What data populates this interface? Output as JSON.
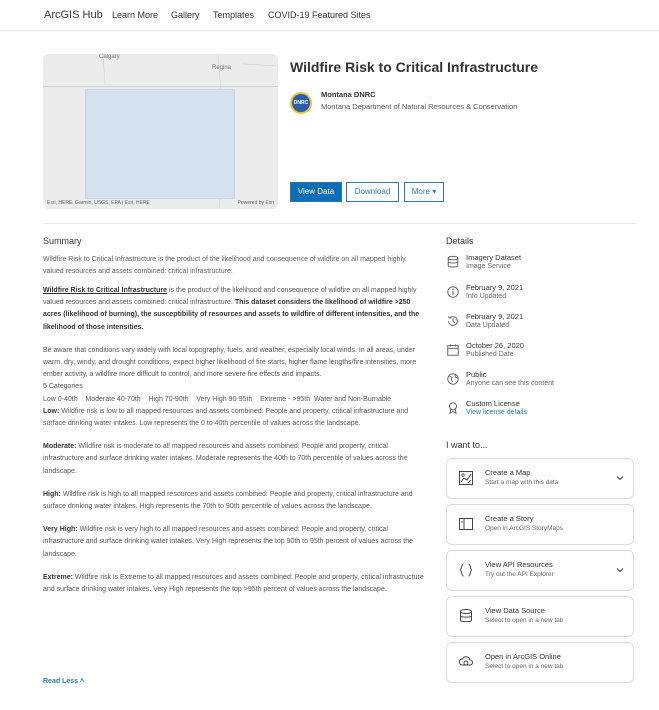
{
  "nav": {
    "brand": "ArcGIS Hub",
    "links": [
      "Learn More",
      "Gallery",
      "Templates",
      "COVID-19 Featured Sites"
    ]
  },
  "map": {
    "cities": [
      "Calgary",
      "Regina"
    ],
    "attribution_left": "Esri, HERE, Garmin, USGS, EPA | Esri, HERE",
    "attribution_right": "Powered by Esri"
  },
  "header": {
    "title": "Wildfire Risk to Critical Infrastructure",
    "org_short": "Montana DNRC",
    "org_full": "Montana Department of Natural Resources & Conservation",
    "org_logo_text": "DNRC"
  },
  "buttons": {
    "view_data": "View Data",
    "download": "Download",
    "more": "More ▾"
  },
  "summary": {
    "heading": "Summary",
    "text": "Wildfire Risk to Critical Infrastructure is the product of the likelihood and consequence of wildfire on all mapped highly valued resources and assets combined: critical infrastructure."
  },
  "description": {
    "p1_title": "Wildfire Risk to Critical Infrastructure",
    "p1_a": " is the product of the likelihood and consequence of wildfire on all mapped highly valued resources and assets combined: critical infrastructure. ",
    "p1_b": "This dataset considers the likelihood of wildfire >250 acres (likelihood of burning), the susceptibility of resources and assets to wildfire of different intensities, and the likelihood of those intensities.",
    "p2": "Be aware that conditions vary widely with local topography, fuels, and weather, especially local winds. In all areas, under warm, dry, windy, and drought conditions, expect higher likelihood of fire starts, higher flame lengths/fire intensities, more ember activity, a wildfire more difficult to control, and more severe fire effects and impacts.",
    "categories_count": "5 Categories",
    "categories_list": "Low 0-40th    Moderate 40-70th    High 70-90th    Very High 90-95th    Extreme - >95th  Water and Non-Burnable",
    "low_label": "Low:",
    "low_text": " Wildfire risk is low to all mapped resources and assets combined: People and property, critical infrastructure and surface drinking water intakes. Low represents the 0 to 40th percentile of values across the landscape.",
    "mod_label": "Moderate:",
    "mod_text": " Wildfire risk is moderate to all mapped resources and assets combined: People and property, critical infrastructure and surface drinking water intakes. Moderate represents the 40th to 70th percentile of values across the landscape.",
    "high_label": "High:",
    "high_text": " Wildfire risk is high to all mapped resources and assets combined: People and property, critical infrastructure and surface drinking water intakes. High represents the 70th to 90th percentile of values across the landscape.",
    "vhigh_label": "Very High:",
    "vhigh_text": " Wildfire risk is very high to all mapped resources and assets combined: People and property, critical infrastructure and surface drinking water intakes. Very High represents the top 90th to 95th percent of values across the landscape.",
    "ext_label": "Extreme:",
    "ext_text": " Wildfire risk is Extreme to all mapped resources and assets combined: People and property, critical infrastructure and surface drinking water intakes. Very High represents the top >95th percent of values across the landscape.",
    "read_less": "Read Less ˄"
  },
  "details": {
    "heading": "Details",
    "items": [
      {
        "icon": "database-icon",
        "line1": "Imagery Dataset",
        "line2": "Image Service"
      },
      {
        "icon": "info-icon",
        "line1": "February 9, 2021",
        "line2": "Info Updated"
      },
      {
        "icon": "history-icon",
        "line1": "February 9, 2021",
        "line2": "Data Updated"
      },
      {
        "icon": "calendar-icon",
        "line1": "October 26, 2020",
        "line2": "Published Date"
      },
      {
        "icon": "globe-icon",
        "line1": "Public",
        "line2": "Anyone can see this content"
      },
      {
        "icon": "license-icon",
        "line1": "Custom License",
        "line2": "View license details"
      }
    ]
  },
  "want": {
    "heading": "I want to...",
    "cards": [
      {
        "icon": "map-icon",
        "title": "Create a Map",
        "sub": "Start a map with this data"
      },
      {
        "icon": "storymap-icon",
        "title": "Create a Story",
        "sub": "Open in ArcGIS StoryMaps"
      },
      {
        "icon": "braces-icon",
        "title": "View API Resources",
        "sub": "Try out the API Explorer"
      },
      {
        "icon": "database-icon",
        "title": "View Data Source",
        "sub": "Select to open in a new tab"
      },
      {
        "icon": "arcgis-online-icon",
        "title": "Open in ArcGIS Online",
        "sub": "Select to open in a new tab"
      }
    ]
  }
}
